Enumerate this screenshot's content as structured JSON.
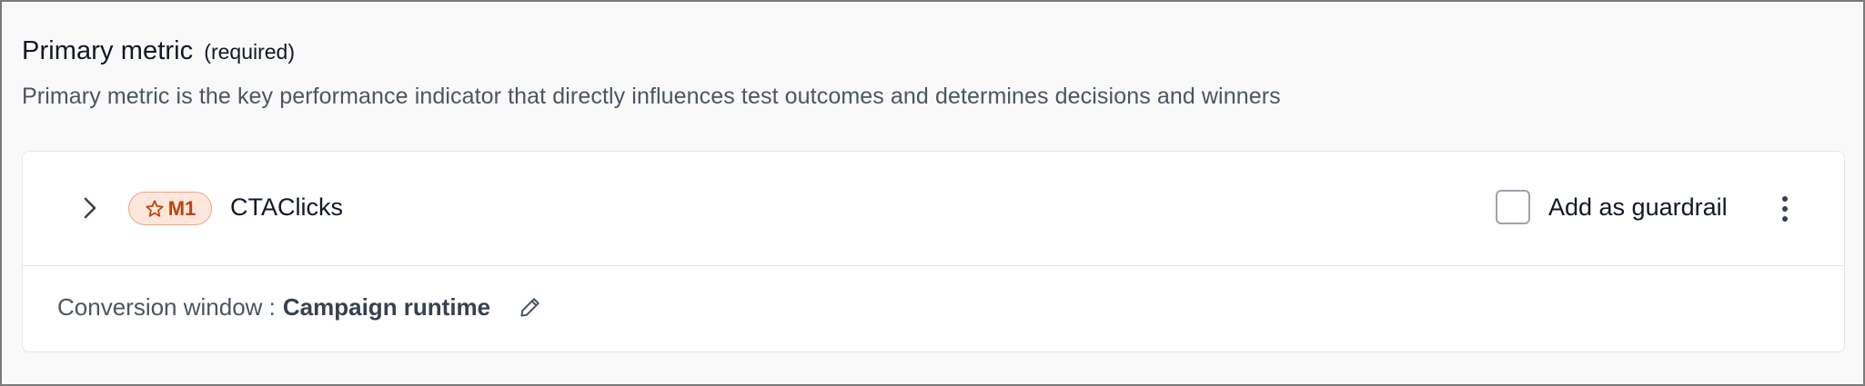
{
  "section": {
    "title": "Primary metric",
    "required_label": "(required)",
    "description": "Primary metric is the key performance indicator that directly influences test outcomes and determines decisions and winners"
  },
  "metric": {
    "badge_icon": "star-icon",
    "badge_label": "M1",
    "name": "CTAClicks",
    "guardrail_label": "Add as guardrail",
    "guardrail_checked": false
  },
  "conversion": {
    "label": "Conversion window :",
    "value": "Campaign runtime"
  },
  "colors": {
    "badge_bg": "#fde7dc",
    "badge_border": "#f4a482",
    "badge_text": "#c2410c"
  }
}
